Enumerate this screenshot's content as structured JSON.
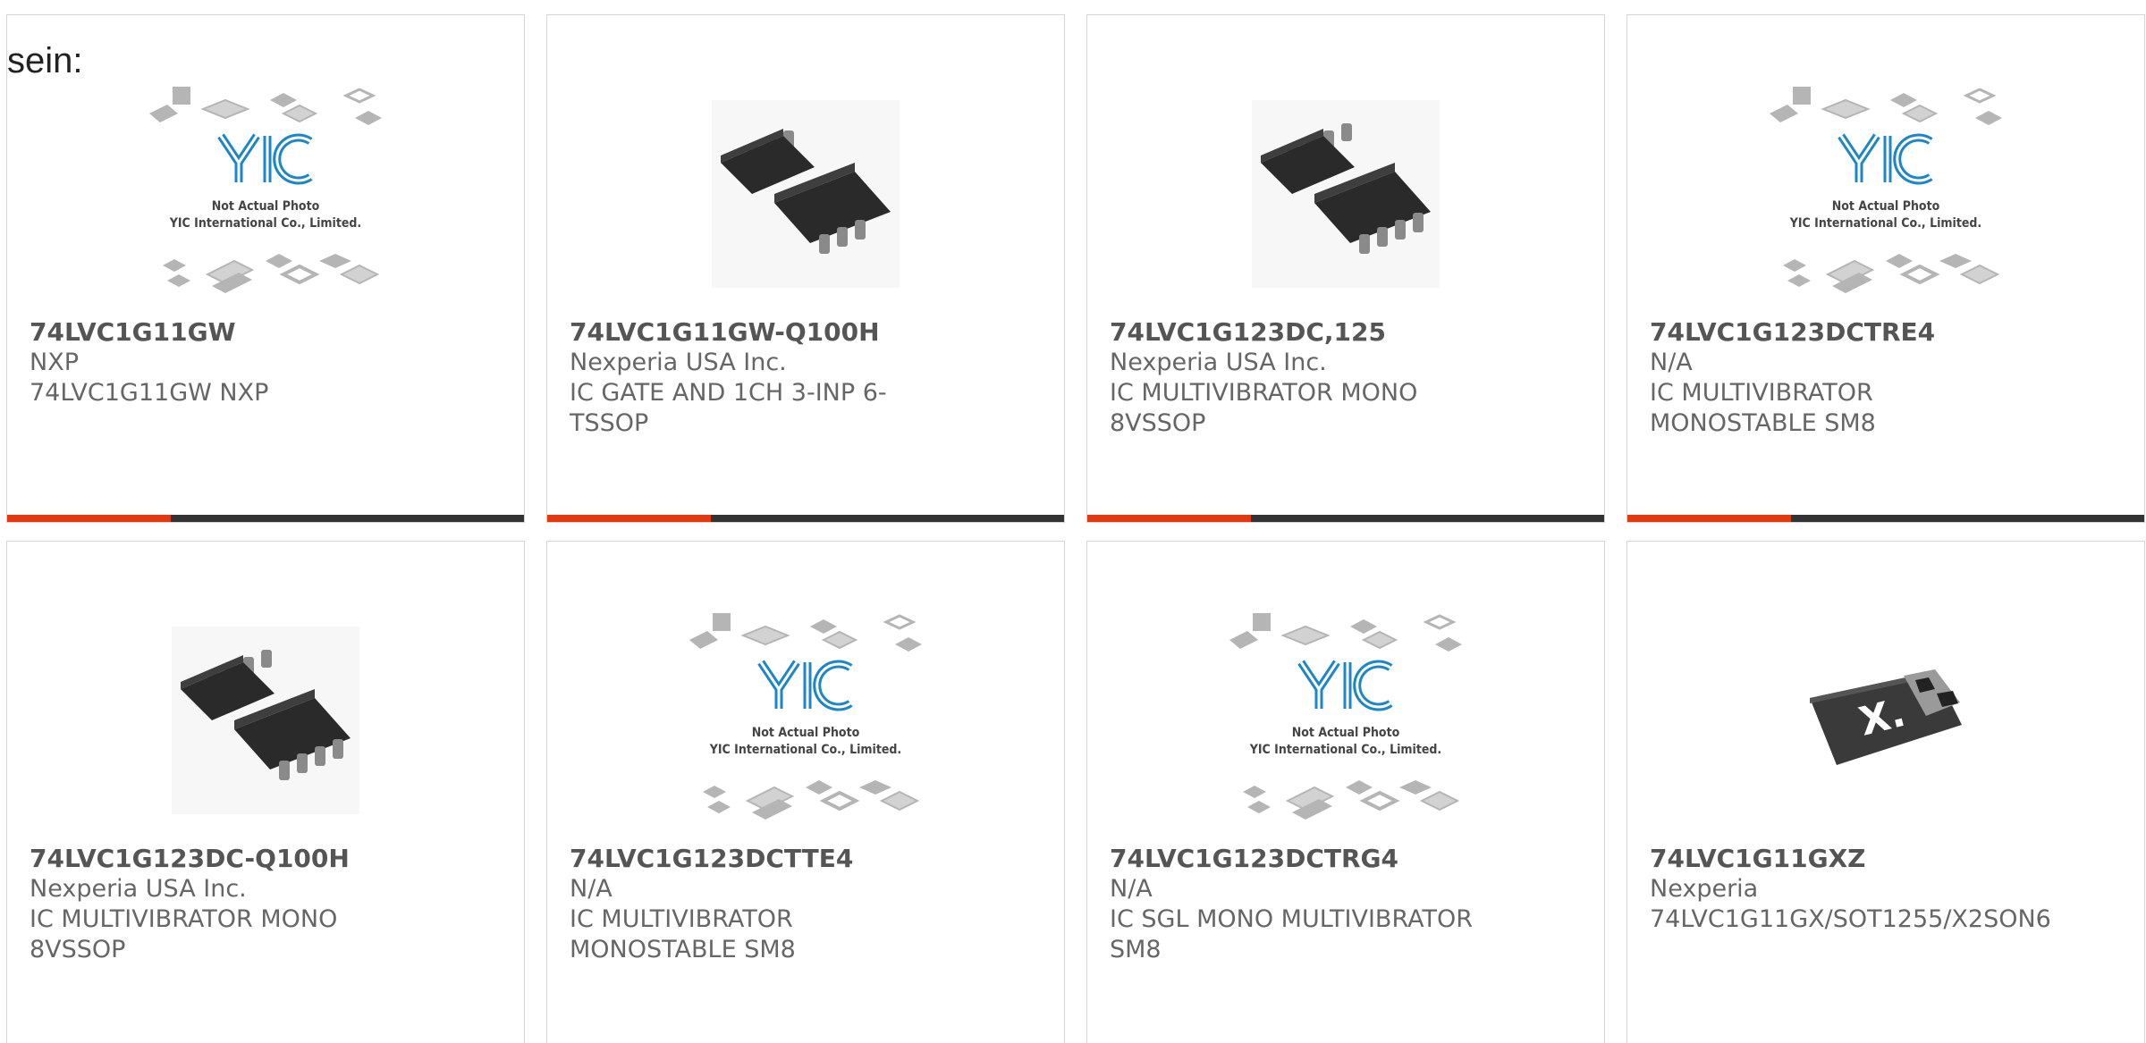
{
  "intro_text": "sein:",
  "colors": {
    "accent": "#e5380f",
    "bar": "#333333",
    "logo": "#1d86c7",
    "border": "#d6d6d6"
  },
  "placeholder": {
    "line1": "Not Actual Photo",
    "line2": "YIC International Co., Limited."
  },
  "products": [
    {
      "part": "74LVC1G11GW",
      "maker": "NXP",
      "desc": "74LVC1G11GW NXP",
      "image": "placeholder",
      "progress_bar": true
    },
    {
      "part": "74LVC1G11GW-Q100H",
      "maker": "Nexperia USA Inc.",
      "desc": "IC GATE AND 1CH 3-INP 6-TSSOP",
      "image": "chip-6pin",
      "progress_bar": true
    },
    {
      "part": "74LVC1G123DC,125",
      "maker": "Nexperia USA Inc.",
      "desc": "IC MULTIVIBRATOR MONO 8VSSOP",
      "image": "chip-8pin",
      "progress_bar": true
    },
    {
      "part": "74LVC1G123DCTRE4",
      "maker": "N/A",
      "desc": "IC MULTIVIBRATOR MONOSTABLE SM8",
      "image": "placeholder",
      "progress_bar": true
    },
    {
      "part": "74LVC1G123DC-Q100H",
      "maker": "Nexperia USA Inc.",
      "desc": "IC MULTIVIBRATOR MONO 8VSSOP",
      "image": "chip-8pin",
      "progress_bar": false
    },
    {
      "part": "74LVC1G123DCTTE4",
      "maker": "N/A",
      "desc": "IC MULTIVIBRATOR MONOSTABLE SM8",
      "image": "placeholder",
      "progress_bar": false
    },
    {
      "part": "74LVC1G123DCTRG4",
      "maker": "N/A",
      "desc": "IC SGL MONO MULTIVIBRATOR SM8",
      "image": "placeholder",
      "progress_bar": false
    },
    {
      "part": "74LVC1G11GXZ",
      "maker": "Nexperia",
      "desc": "74LVC1G11GX/SOT1255/X2SON6",
      "image": "chip-x2son",
      "progress_bar": false
    }
  ]
}
